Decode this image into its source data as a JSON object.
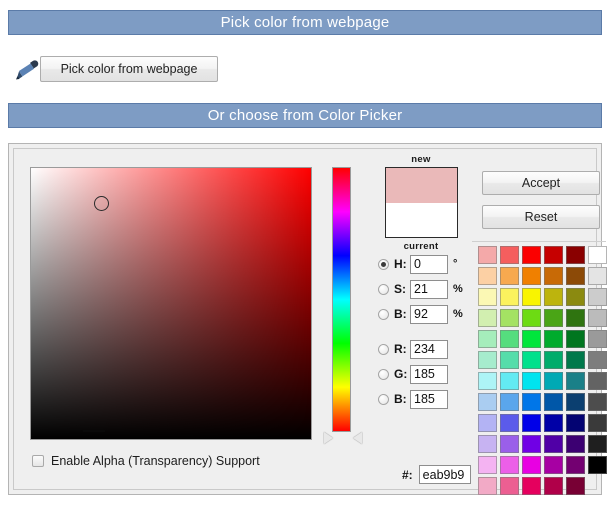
{
  "sections": {
    "pick_header": "Pick color from webpage",
    "choose_header": "Or choose from Color Picker"
  },
  "picker_row": {
    "eyedropper_icon": "eyedropper-icon",
    "button_label": "Pick color from webpage"
  },
  "preview": {
    "new_label": "new",
    "current_label": "current",
    "new_color": "#eab9b9",
    "current_color": "#ffffff"
  },
  "buttons": {
    "accept": "Accept",
    "reset": "Reset"
  },
  "fields": {
    "hsb": [
      {
        "key": "H",
        "label": "H:",
        "value": "0",
        "unit": "°",
        "selected": true
      },
      {
        "key": "S",
        "label": "S:",
        "value": "21",
        "unit": "%",
        "selected": false
      },
      {
        "key": "B",
        "label": "B:",
        "value": "92",
        "unit": "%",
        "selected": false
      }
    ],
    "rgb": [
      {
        "key": "R",
        "label": "R:",
        "value": "234",
        "unit": "",
        "selected": false
      },
      {
        "key": "G",
        "label": "G:",
        "value": "185",
        "unit": "",
        "selected": false
      },
      {
        "key": "B",
        "label": "B:",
        "value": "185",
        "unit": "",
        "selected": false
      }
    ],
    "hex_label": "#:",
    "hex_value": "eab9b9"
  },
  "alpha": {
    "label": "Enable Alpha (Transparency) Support",
    "checked": false
  },
  "gradient": {
    "hue_degrees": 0,
    "base_color": "#ff0000",
    "cursor_x_pct": 25,
    "cursor_y_pct": 13
  },
  "theme": {
    "header_bar": "#7e9cc4",
    "header_bar_border": "#5b7ba8",
    "header_text": "#ffffff",
    "panel_bg": "#efefef",
    "panel_border": "#b4b4b4"
  },
  "palette": [
    [
      "#f4a9a9",
      "#f55e5e",
      "#fb0000",
      "#c60000",
      "#8a0000",
      "#ffffff"
    ],
    [
      "#fcd0a4",
      "#f7a94f",
      "#f08000",
      "#c86a06",
      "#8c4a07",
      "#e4e4e4"
    ],
    [
      "#fbf8b4",
      "#fbf25e",
      "#f9f400",
      "#bdb40d",
      "#8b8a10",
      "#cccccc"
    ],
    [
      "#d2efb0",
      "#a4e263",
      "#6ddb13",
      "#4aa516",
      "#2f7410",
      "#bbbbbb"
    ],
    [
      "#a5edbb",
      "#55dd7e",
      "#00e63c",
      "#00ab2d",
      "#00761f",
      "#9a9a9a"
    ],
    [
      "#a6eccd",
      "#56ddaa",
      "#00e18c",
      "#00ac6b",
      "#00794b",
      "#7d7d7d"
    ],
    [
      "#adf4f6",
      "#63eaf2",
      "#00e4ef",
      "#00a9b4",
      "#1a8088",
      "#636363"
    ],
    [
      "#aacdf1",
      "#5aa6ec",
      "#0076e8",
      "#0057a8",
      "#0b3f70",
      "#4d4d4d"
    ],
    [
      "#b3b3f4",
      "#5b5bea",
      "#0000e8",
      "#0000a7",
      "#030372",
      "#3a3a3a"
    ],
    [
      "#c7b3f2",
      "#9a5fe9",
      "#7000e5",
      "#5000a6",
      "#3c0072",
      "#1f1f1f"
    ],
    [
      "#f4b3f2",
      "#ec5fe8",
      "#e800e2",
      "#a700a3",
      "#730071",
      "#000000"
    ],
    [
      "#f2aac6",
      "#ec5f92",
      "#e5005e",
      "#b00049",
      "#780034",
      ""
    ]
  ]
}
